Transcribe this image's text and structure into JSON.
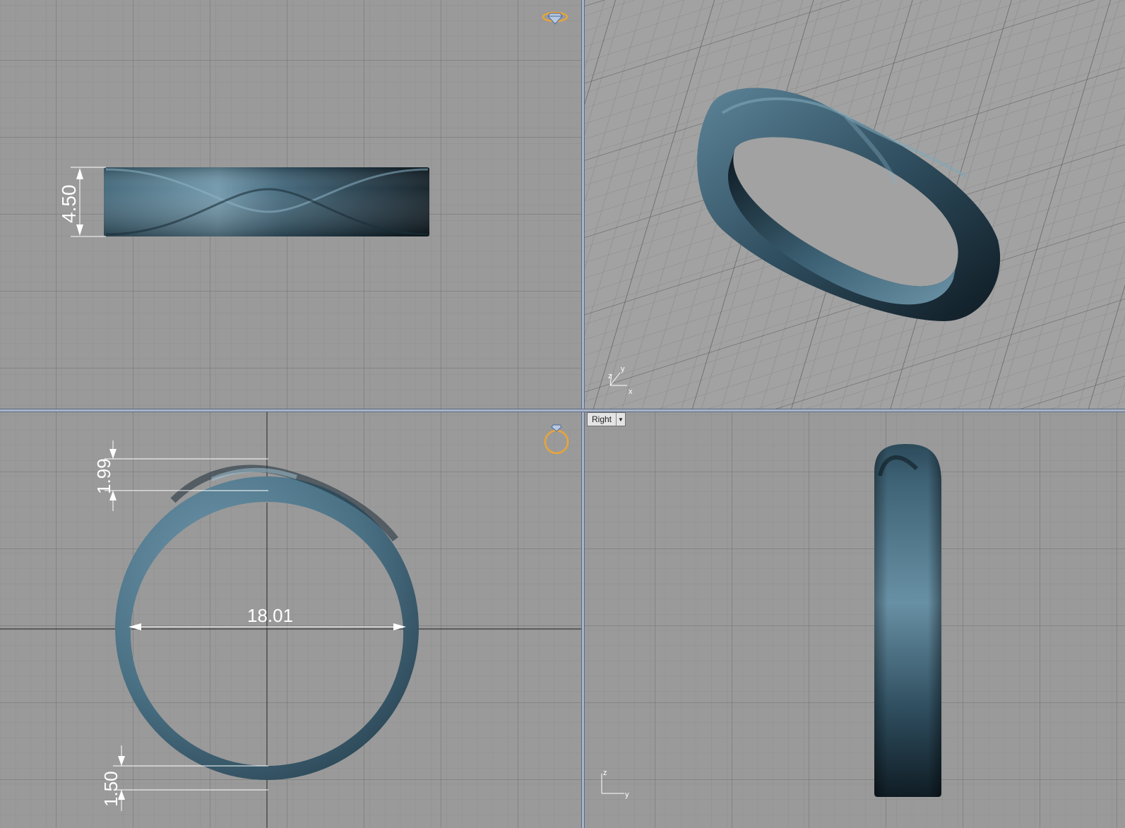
{
  "viewports": {
    "right": {
      "label": "Right"
    }
  },
  "dimensions": {
    "band_width": "4.50",
    "top_thickness": "1.99",
    "inner_diameter": "18.01",
    "bottom_thickness": "1.50"
  },
  "axes": {
    "perspective": {
      "x": "x",
      "y": "y",
      "z": "z"
    },
    "right": {
      "y": "y",
      "z": "z"
    }
  },
  "icons": {
    "top_view_gizmo": "ring-with-diamond-icon",
    "front_view_gizmo": "ring-front-icon"
  },
  "colors": {
    "ring": "#4a7287",
    "grid_bg": "#9a9a9a",
    "grid_minor": "#8e8e8e",
    "grid_major": "#7a7a7a",
    "gizmo": "#e8a53a"
  }
}
